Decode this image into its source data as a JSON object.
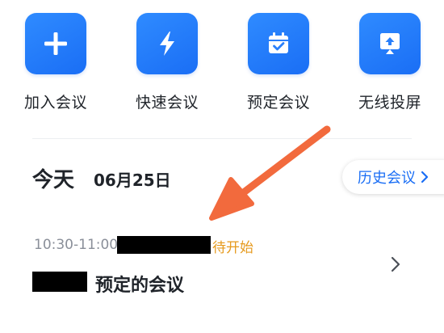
{
  "quick_actions": [
    {
      "label": "加入会议",
      "icon": "plus-icon"
    },
    {
      "label": "快速会议",
      "icon": "lightning-icon"
    },
    {
      "label": "预定会议",
      "icon": "calendar-check-icon"
    },
    {
      "label": "无线投屏",
      "icon": "screen-cast-icon"
    }
  ],
  "schedule": {
    "day_label": "今天",
    "date": "06月25日",
    "history_button": "历史会议"
  },
  "meeting": {
    "time": "10:30-11:00",
    "status": "待开始",
    "title": "预定的会议"
  },
  "colors": {
    "accent": "#1a6ef5",
    "status": "#e69a1d",
    "annotation_arrow": "#f26a3d"
  }
}
